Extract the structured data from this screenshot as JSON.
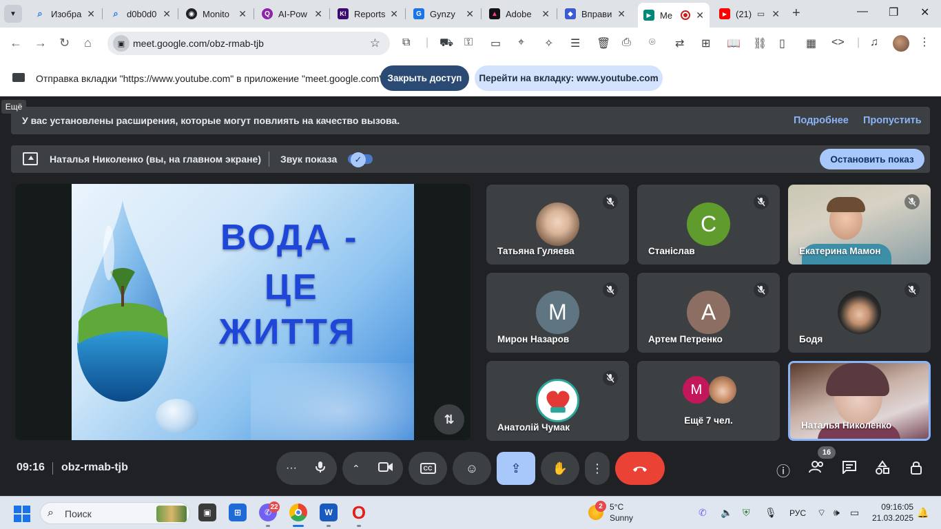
{
  "browser": {
    "tabs": [
      {
        "title": "Изобра",
        "favicon_color": "#1a73e8",
        "favicon_glyph": "🔍",
        "icon": "search-icon"
      },
      {
        "title": "d0b0d0",
        "favicon_color": "#1a73e8",
        "favicon_glyph": "🔍",
        "icon": "search-icon"
      },
      {
        "title": "Monito",
        "favicon_color": "#202124",
        "favicon_glyph": "◉",
        "icon": "monitor-icon"
      },
      {
        "title": "AI-Pow",
        "favicon_color": "#8e24aa",
        "favicon_glyph": "Q",
        "icon": "quizizz-icon"
      },
      {
        "title": "Reports",
        "favicon_color": "#3b0a6e",
        "favicon_glyph": "K!",
        "icon": "kahoot-icon"
      },
      {
        "title": "Gynzy",
        "favicon_color": "#1a73e8",
        "favicon_glyph": "G",
        "icon": "gynzy-icon"
      },
      {
        "title": "Adobe",
        "favicon_color": "#111111",
        "favicon_glyph": "▲",
        "icon": "adobe-icon"
      },
      {
        "title": "Вправи",
        "favicon_color": "#3b5bd1",
        "favicon_glyph": "◆",
        "icon": "wordwall-icon"
      },
      {
        "title": "Me",
        "favicon_color": "#00897b",
        "favicon_glyph": "▶",
        "icon": "meet-icon",
        "active": true
      },
      {
        "title": "(21)",
        "favicon_color": "#ff0000",
        "favicon_glyph": "▶",
        "icon": "youtube-icon"
      }
    ],
    "url": "meet.google.com/obz-rmab-tjb"
  },
  "infobar": {
    "text": "Отправка вкладки \"https://www.youtube.com\" в приложение \"meet.google.com\"...",
    "stop_access": "Закрыть доступ",
    "goto_tab": "Перейти на вкладку: www.youtube.com"
  },
  "tooltip": "Ещё",
  "banner": {
    "text": "У вас установлены расширения, которые могут повлиять на качество вызова.",
    "learn_more": "Подробнее",
    "dismiss": "Пропустить"
  },
  "presenting": {
    "name": "Наталья Николенко (вы, на главном экране)",
    "audio_label": "Звук показа",
    "audio_on": true,
    "stop_label": "Остановить показ"
  },
  "slide": {
    "line1": "ВОДА -",
    "line2": "ЦЕ",
    "line3": "ЖИТТЯ"
  },
  "participants": [
    {
      "name": "Татьяна Гуляева",
      "type": "photo",
      "muted": true,
      "avatar_color": "#b08a6a"
    },
    {
      "name": "Станіслав",
      "type": "letter",
      "letter": "С",
      "muted": true,
      "avatar_color": "#5f9b2d"
    },
    {
      "name": "Екатерина Мамон",
      "type": "video",
      "muted": true
    },
    {
      "name": "Мирон Назаров",
      "type": "letter",
      "letter": "М",
      "muted": true,
      "avatar_color": "#5f7682"
    },
    {
      "name": "Артем Петренко",
      "type": "letter",
      "letter": "А",
      "muted": true,
      "avatar_color": "#8d6e63"
    },
    {
      "name": "Бодя",
      "type": "photo",
      "muted": true,
      "avatar_color": "#2b2b2b"
    },
    {
      "name": "Анатолій Чумак",
      "type": "photo",
      "muted": true,
      "avatar_color": "#ffffff"
    },
    {
      "name": "Ещё 7 чел.",
      "type": "more",
      "muted": false,
      "avatar_letter": "M",
      "avatar_color": "#c2185b"
    },
    {
      "name": "Наталья Николенко",
      "type": "self",
      "muted": false
    }
  ],
  "meeting": {
    "time": "09:16",
    "code": "obz-rmab-tjb",
    "participant_count": "16"
  },
  "taskbar": {
    "search_placeholder": "Поиск",
    "viber_badge": "22",
    "weather_badge": "2",
    "weather_temp": "5°C",
    "weather_cond": "Sunny",
    "language": "РУС",
    "time": "09:16:05",
    "date": "21.03.2025"
  },
  "colors": {
    "meet_bg": "#202124",
    "tile_bg": "#3c4043",
    "accent_blue": "#a8c7fa",
    "hangup_red": "#ea4335",
    "link_blue": "#8ab4f8"
  }
}
